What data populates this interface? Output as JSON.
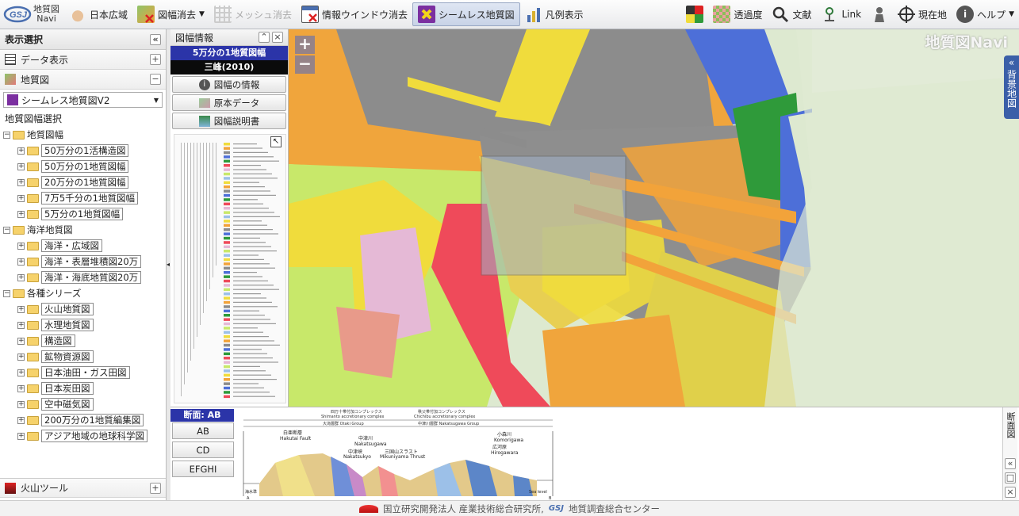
{
  "toolbar": {
    "logo_line1": "地質図",
    "logo_line2": "Navi",
    "japan_wide": "日本広域",
    "sheet_clear": "図幅消去",
    "mesh_clear": "メッシュ消去",
    "info_window_clear": "情報ウインドウ消去",
    "seamless_map": "シームレス地質図",
    "legend_display": "凡例表示",
    "transparency": "透過度",
    "literature": "文献",
    "link": "Link",
    "current_location": "現在地",
    "help": "ヘルプ"
  },
  "left_panel": {
    "title": "表示選択",
    "data_display": "データ表示",
    "geo_map": "地質図",
    "select_value": "シームレス地質図V2",
    "sheet_select_label": "地質図幅選択",
    "tree": [
      {
        "label": "地質図幅",
        "level": 0,
        "expanded": true
      },
      {
        "label": "50万分の1活構造図",
        "level": 1
      },
      {
        "label": "50万分の1地質図幅",
        "level": 1
      },
      {
        "label": "20万分の1地質図幅",
        "level": 1
      },
      {
        "label": "7万5千分の1地質図幅",
        "level": 1
      },
      {
        "label": "5万分の1地質図幅",
        "level": 1
      },
      {
        "label": "海洋地質図",
        "level": 0,
        "expanded": true
      },
      {
        "label": "海洋・広域図",
        "level": 1
      },
      {
        "label": "海洋・表層堆積図20万",
        "level": 1
      },
      {
        "label": "海洋・海底地質図20万",
        "level": 1
      },
      {
        "label": "各種シリーズ",
        "level": 0,
        "expanded": true
      },
      {
        "label": "火山地質図",
        "level": 1
      },
      {
        "label": "水理地質図",
        "level": 1
      },
      {
        "label": "構造図",
        "level": 1
      },
      {
        "label": "鉱物資源図",
        "level": 1
      },
      {
        "label": "日本油田・ガス田図",
        "level": 1
      },
      {
        "label": "日本炭田図",
        "level": 1
      },
      {
        "label": "空中磁気図",
        "level": 1
      },
      {
        "label": "200万分の1地質編集図",
        "level": 1
      },
      {
        "label": "アジア地域の地球科学図",
        "level": 1
      }
    ],
    "volcano_tool": "火山ツール"
  },
  "sheet_info": {
    "title": "図幅情報",
    "scale_label": "5万分の1地質図幅",
    "sheet_name": "三峰(2010)",
    "info_button": "図幅の情報",
    "original_data_button": "原本データ",
    "explanation_button": "図幅説明書"
  },
  "map": {
    "brand": "地質図Navi",
    "zoom_in": "+",
    "zoom_out": "−",
    "background_map_tab": "背景地図"
  },
  "section": {
    "header": "断面: AB",
    "tabs": [
      "AB",
      "CD",
      "EFGHI"
    ],
    "right_tab": "断面図",
    "fig_texts": {
      "complex1": "四万十帯付加コンプレックス",
      "complex1_en": "Shimanto accretionary complex",
      "complex2": "秩父帯付加コンプレックス",
      "complex2_en": "Chichibu accretionary complex",
      "group1": "大滝層群 Otaki Group",
      "group2": "中津川層群 Nakatsugawa Group",
      "fault1": "白亜断層",
      "fault1_en": "Hakutai Fault",
      "fault2": "中津川",
      "fault2_en": "Nakatsugawa",
      "fault3": "中津峡",
      "fault3_en": "Nakatsukyo",
      "thrust": "三国山スラスト",
      "thrust_en": "Mikuniyama Thrust",
      "river1": "小森川",
      "river1_en": "Komorigawa",
      "river2": "広河原",
      "river2_en": "Hirogawara",
      "sea_level": "Sea level",
      "left_note": "海水準",
      "point_a": "A",
      "point_b": "B"
    }
  },
  "footer": {
    "org1": "国立研究開発法人 産業技術総合研究所,",
    "org2": "地質調査総合センター"
  },
  "colors": {
    "accent_blue": "#2b34a8",
    "geo_gray": "#8c8c8c",
    "geo_orange": "#f2a33a",
    "geo_red": "#ef4a5a",
    "geo_yellow": "#f0dc3c",
    "geo_green": "#2f9a3a",
    "geo_blue": "#4d6fd8",
    "geo_pink": "#e5b9d6",
    "geo_lightgreen": "#c8e86a"
  }
}
